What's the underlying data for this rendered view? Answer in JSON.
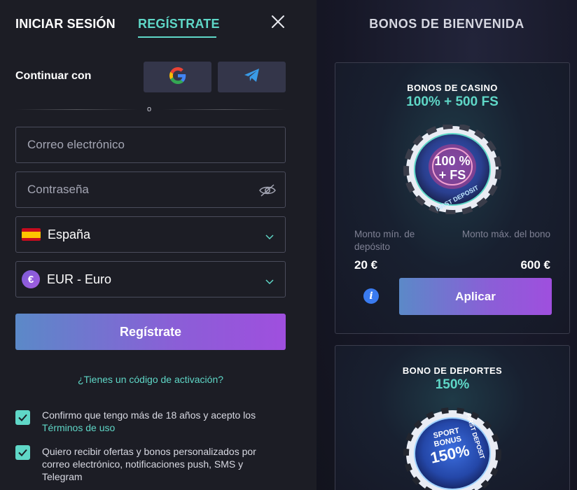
{
  "auth": {
    "tab_login": "INICIAR SESIÓN",
    "tab_register": "REGÍSTRATE",
    "active_tab": "register",
    "continue_label": "Continuar con",
    "divider_text": "o",
    "email_placeholder": "Correo electrónico",
    "password_placeholder": "Contraseña",
    "country": "España",
    "currency": "EUR - Euro",
    "currency_symbol": "€",
    "register_button": "Regístrate",
    "activation_link": "¿Tienes un código de activación?",
    "consent_1_text": "Confirmo que tengo más de 18 años y acepto los ",
    "consent_1_link": "Términos de uso",
    "consent_1_checked": true,
    "consent_2_text": "Quiero recibir ofertas y bonos personalizados por correo electrónico, notificaciones push, SMS y Telegram",
    "consent_2_checked": true
  },
  "bonuses": {
    "header": "BONOS DE BIENVENIDA",
    "casino": {
      "title": "BONOS DE CASINO",
      "subtitle": "100% + 500 FS",
      "chip_line1": "100 %",
      "chip_line2": "+ FS",
      "chip_ring": "FIRST DEPOSIT",
      "min_label": "Monto mín. de depósito",
      "max_label": "Monto máx. del bono",
      "min_value": "20 €",
      "max_value": "600 €",
      "info_symbol": "i",
      "apply_button": "Aplicar"
    },
    "sport": {
      "title": "BONO DE DEPORTES",
      "subtitle": "150%",
      "chip_line1": "SPORT",
      "chip_line2": "BONUS",
      "chip_line3": "150%",
      "chip_ring": "FIRST DEPOSIT"
    }
  },
  "colors": {
    "accent": "#5fd7c7",
    "button_gradient_start": "#5b89c8",
    "button_gradient_end": "#9f4fde",
    "info_blue": "#3a7bf0"
  },
  "icons": [
    "close-icon",
    "google-icon",
    "telegram-icon",
    "eye-off-icon",
    "chevron-down-icon",
    "spain-flag-icon",
    "euro-icon",
    "check-icon",
    "info-icon"
  ]
}
